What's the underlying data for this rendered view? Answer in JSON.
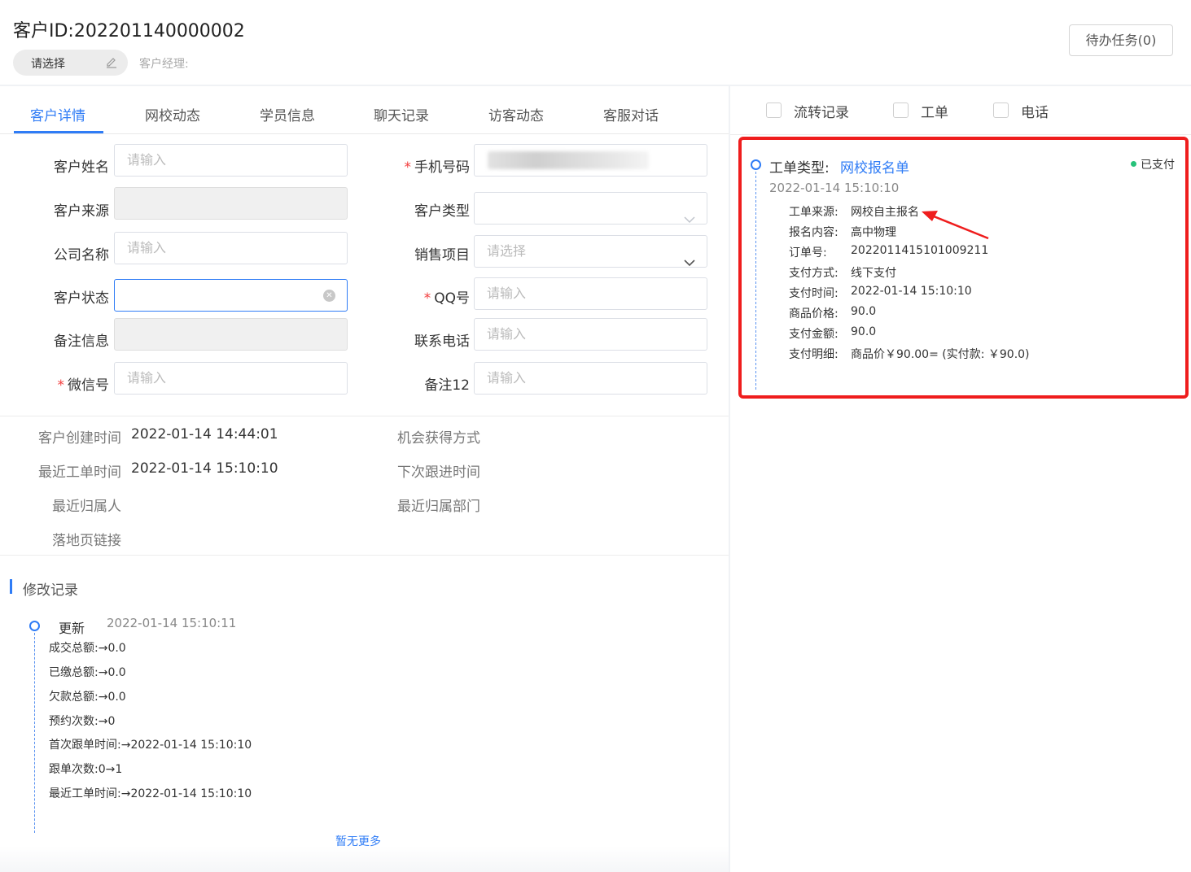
{
  "header": {
    "title": "客户ID:202201140000002",
    "select_label": "请选择",
    "manager_label": "客户经理:",
    "todo_button": "待办任务(0)"
  },
  "tabs": [
    {
      "label": "客户详情",
      "active": true
    },
    {
      "label": "网校动态",
      "active": false
    },
    {
      "label": "学员信息",
      "active": false
    },
    {
      "label": "聊天记录",
      "active": false
    },
    {
      "label": "访客动态",
      "active": false
    },
    {
      "label": "客服对话",
      "active": false
    }
  ],
  "form": {
    "left": [
      {
        "label": "客户姓名",
        "required": false,
        "placeholder": "请输入",
        "state": "normal"
      },
      {
        "label": "客户来源",
        "required": false,
        "placeholder": "",
        "state": "disabled"
      },
      {
        "label": "公司名称",
        "required": false,
        "placeholder": "请输入",
        "state": "normal"
      },
      {
        "label": "客户状态",
        "required": false,
        "placeholder": "",
        "state": "focus"
      },
      {
        "label": "备注信息",
        "required": false,
        "placeholder": "",
        "state": "disabled"
      },
      {
        "label": "微信号",
        "required": true,
        "placeholder": "请输入",
        "state": "normal"
      }
    ],
    "right": [
      {
        "label": "手机号码",
        "required": true,
        "placeholder": "",
        "state": "blurred"
      },
      {
        "label": "客户类型",
        "required": false,
        "placeholder": "",
        "state": "select"
      },
      {
        "label": "销售项目",
        "required": false,
        "placeholder": "请选择",
        "state": "select"
      },
      {
        "label": "QQ号",
        "required": true,
        "placeholder": "请输入",
        "state": "normal"
      },
      {
        "label": "联系电话",
        "required": false,
        "placeholder": "请输入",
        "state": "normal"
      },
      {
        "label": "备注12",
        "required": false,
        "placeholder": "请输入",
        "state": "normal"
      }
    ]
  },
  "info": {
    "created_label": "客户创建时间",
    "created_value": "2022-01-14 14:44:01",
    "last_order_label": "最近工单时间",
    "last_order_value": "2022-01-14 15:10:10",
    "last_owner_label": "最近归属人",
    "landing_label": "落地页链接",
    "opportunity_label": "机会获得方式",
    "next_follow_label": "下次跟进时间",
    "last_dept_label": "最近归属部门"
  },
  "history": {
    "title": "修改记录",
    "entry_type": "更新",
    "entry_time": "2022-01-14 15:10:11",
    "items": [
      "成交总额:→0.0",
      "已缴总额:→0.0",
      "欠款总额:→0.0",
      "预约次数:→0",
      "首次跟单时间:→2022-01-14 15:10:10",
      "跟单次数:0→1",
      "最近工单时间:→2022-01-14 15:10:10"
    ],
    "no_more": "暂无更多"
  },
  "filters": [
    {
      "label": "流转记录",
      "checked": false
    },
    {
      "label": "工单",
      "checked": false
    },
    {
      "label": "电话",
      "checked": false
    }
  ],
  "work_order": {
    "type_label": "工单类型:",
    "type_value": "网校报名单",
    "status": "已支付",
    "status_color": "#27c27a",
    "time": "2022-01-14 15:10:10",
    "rows": [
      {
        "key": "工单来源:",
        "value": "网校自主报名"
      },
      {
        "key": "报名内容:",
        "value": "高中物理"
      },
      {
        "key": "订单号:",
        "value": "2022011415101009211"
      },
      {
        "key": "支付方式:",
        "value": "线下支付"
      },
      {
        "key": "支付时间:",
        "value": "2022-01-14 15:10:10"
      },
      {
        "key": "商品价格:",
        "value": "90.0"
      },
      {
        "key": "支付金额:",
        "value": "90.0"
      },
      {
        "key": "支付明细:",
        "value": "商品价￥90.00= (实付款: ￥90.0)"
      }
    ]
  },
  "colors": {
    "accent": "#2f7cf6",
    "highlight_border": "#ef1d1d",
    "required": "#f23b3b"
  }
}
